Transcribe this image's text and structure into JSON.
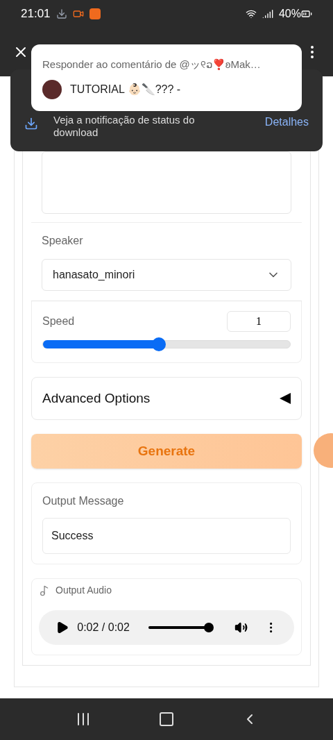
{
  "status_bar": {
    "time": "21:01",
    "battery": "40%"
  },
  "download_toast": {
    "message": "Veja a notificação de status do download",
    "action": "Detalhes"
  },
  "notification": {
    "title": "Responder ao comentário de @ッ୧⁠ວ❣️ʚMak…",
    "body": "TUTORIAL 👶🏻🔪??? -"
  },
  "form": {
    "speaker": {
      "label": "Speaker",
      "value": "hanasato_minori"
    },
    "speed": {
      "label": "Speed",
      "value": "1",
      "level": 0.47
    },
    "advanced": {
      "label": "Advanced Options",
      "expanded": false
    },
    "generate_button": "Generate",
    "output_message": {
      "label": "Output Message",
      "value": "Success"
    },
    "output_audio": {
      "label": "Output Audio",
      "time": "0:02 / 0:02",
      "level": 1
    }
  }
}
